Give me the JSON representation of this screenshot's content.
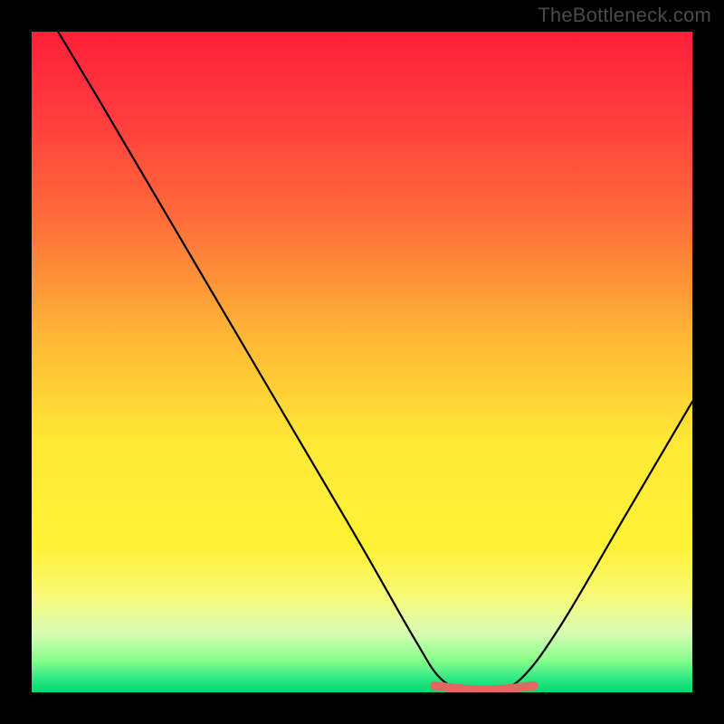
{
  "watermark": "TheBottleneck.com",
  "chart_data": {
    "type": "line",
    "title": "",
    "xlabel": "",
    "ylabel": "",
    "xlim": [
      0,
      100
    ],
    "ylim": [
      0,
      100
    ],
    "series": [
      {
        "name": "bottleneck-curve",
        "x": [
          4,
          10,
          20,
          30,
          40,
          50,
          58,
          62,
          66,
          70,
          74,
          80,
          90,
          100
        ],
        "values": [
          100,
          90,
          73,
          56,
          39,
          22,
          8,
          2,
          0.5,
          0.5,
          2,
          10,
          27,
          44
        ]
      },
      {
        "name": "red-plateau-marker",
        "x": [
          61,
          64,
          67,
          70,
          73,
          76
        ],
        "values": [
          1.0,
          0.6,
          0.4,
          0.4,
          0.6,
          1.0
        ]
      }
    ],
    "background": {
      "type": "gradient-rainbow",
      "colors_top_to_bottom": [
        "#ff1f3a",
        "#ff5a3a",
        "#ffb236",
        "#fff236",
        "#f6fa7e",
        "#8cff8c",
        "#00d870"
      ]
    }
  }
}
